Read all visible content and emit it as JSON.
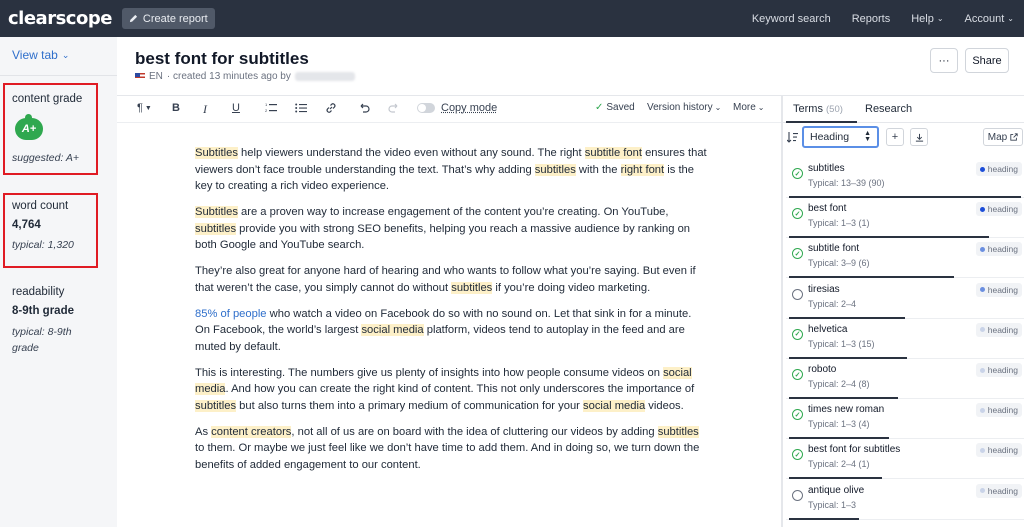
{
  "topbar": {
    "logo": "clearscope",
    "create_report": "Create report",
    "nav": [
      "Keyword search",
      "Reports",
      "Help",
      "Account"
    ]
  },
  "sidebar": {
    "view_tab": "View tab",
    "content_grade": {
      "label": "content grade",
      "value": "A+",
      "suggested": "suggested: A+"
    },
    "word_count": {
      "label": "word count",
      "value": "4,764",
      "typical": "typical: 1,320"
    },
    "readability": {
      "label": "readability",
      "value": "8-9th grade",
      "typical_line1": "typical: 8-9th",
      "typical_line2": "grade"
    }
  },
  "document": {
    "title": "best font for subtitles",
    "lang": "EN",
    "meta": "· created 13 minutes ago by",
    "more_btn": "···",
    "share_btn": "Share"
  },
  "toolbar": {
    "paragraph": "¶",
    "bold": "B",
    "italic": "I",
    "underline": "U",
    "copy_mode": "Copy mode",
    "saved": "Saved",
    "version_history": "Version history",
    "more": "More"
  },
  "paragraphs": [
    [
      {
        "t": "Subtitles",
        "h": 1
      },
      {
        "t": " help viewers understand the video even without any sound. The right "
      },
      {
        "t": "subtitle font",
        "h": 1
      },
      {
        "t": " ensures that viewers don’t face trouble understanding the text. That’s why adding "
      },
      {
        "t": "subtitles",
        "h": 1
      },
      {
        "t": " with the "
      },
      {
        "t": "right font",
        "h": 1
      },
      {
        "t": " is the key to creating a rich video experience."
      }
    ],
    [
      {
        "t": "Subtitles",
        "h": 1
      },
      {
        "t": " are a proven way to increase engagement of the content you’re creating. On YouTube, "
      },
      {
        "t": "subtitles",
        "h": 1
      },
      {
        "t": " provide you with strong SEO benefits, helping you reach a massive audience by ranking on both Google and YouTube search."
      }
    ],
    [
      {
        "t": "They’re also great for anyone hard of hearing and who wants to follow what you’re saying. But even if that weren’t the case, you simply cannot do without "
      },
      {
        "t": "subtitles",
        "h": 1
      },
      {
        "t": " if you’re doing video marketing."
      }
    ],
    [
      {
        "t": "85% of people",
        "l": 1
      },
      {
        "t": " who watch a video on Facebook do so with no sound on. Let that sink in for a minute. On Facebook, the world’s largest "
      },
      {
        "t": "social media",
        "h": 1
      },
      {
        "t": " platform, videos tend to autoplay in the feed and are muted by default."
      }
    ],
    [
      {
        "t": "This is interesting. The numbers give us plenty of insights into how people consume videos on "
      },
      {
        "t": "social media",
        "h": 1
      },
      {
        "t": ". And how you can create the right kind of content. This not only underscores the importance of "
      },
      {
        "t": "subtitles",
        "h": 1
      },
      {
        "t": " but also turns them into a primary medium of communication for your "
      },
      {
        "t": "social media",
        "h": 1
      },
      {
        "t": " videos."
      }
    ],
    [
      {
        "t": "As "
      },
      {
        "t": "content creators",
        "h": 1
      },
      {
        "t": ", not all of us are on board with the idea of cluttering our videos by adding "
      },
      {
        "t": "subtitles",
        "h": 1
      },
      {
        "t": " to them. Or maybe we just feel like we don’t have time to add them. And in doing so, we turn down the benefits of added engagement to our content."
      }
    ]
  ],
  "panel": {
    "tab_terms": "Terms",
    "tab_terms_count": "(50)",
    "tab_research": "Research",
    "sort_select": "Heading",
    "map_btn": "Map",
    "terms": [
      {
        "name": "subtitles",
        "typical": "Typical: 13–39 (90)",
        "done": true,
        "tag": "heading",
        "dot": "#1d4ed8",
        "progress": 1.0
      },
      {
        "name": "best font",
        "typical": "Typical: 1–3 (1)",
        "done": true,
        "tag": "heading",
        "dot": "#1d4ed8",
        "progress": 0.86
      },
      {
        "name": "subtitle font",
        "typical": "Typical: 3–9 (6)",
        "done": true,
        "tag": "heading",
        "dot": "#6b8fe0",
        "progress": 0.71
      },
      {
        "name": "tiresias",
        "typical": "Typical: 2–4",
        "done": false,
        "tag": "heading",
        "dot": "#6b8fe0",
        "progress": 0.5
      },
      {
        "name": "helvetica",
        "typical": "Typical: 1–3 (15)",
        "done": true,
        "tag": "heading",
        "dot": "#c9d3e8",
        "progress": 0.51
      },
      {
        "name": "roboto",
        "typical": "Typical: 2–4 (8)",
        "done": true,
        "tag": "heading",
        "dot": "#c9d3e8",
        "progress": 0.47
      },
      {
        "name": "times new roman",
        "typical": "Typical: 1–3 (4)",
        "done": true,
        "tag": "heading",
        "dot": "#c9d3e8",
        "progress": 0.43
      },
      {
        "name": "best font for subtitles",
        "typical": "Typical: 2–4 (1)",
        "done": true,
        "tag": "heading",
        "dot": "#c9d3e8",
        "progress": 0.4
      },
      {
        "name": "antique olive",
        "typical": "Typical: 1–3",
        "done": false,
        "tag": "heading",
        "dot": "#c9d3e8",
        "progress": 0.3
      }
    ]
  }
}
